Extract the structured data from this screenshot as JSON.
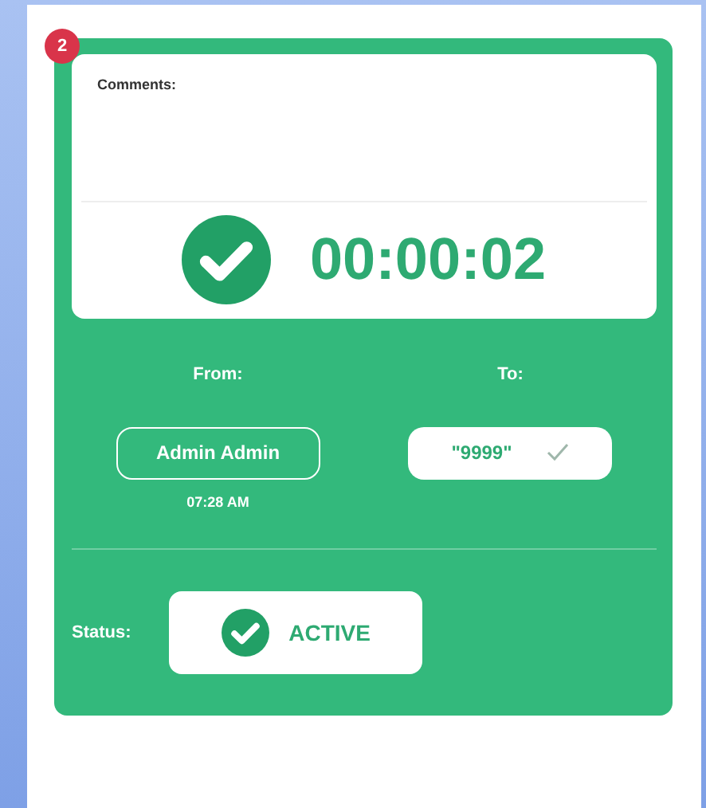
{
  "badge": "2",
  "comments": {
    "label": "Comments:"
  },
  "timer": {
    "done": true,
    "time": "00:00:02"
  },
  "from": {
    "label": "From:",
    "user": "Admin Admin",
    "time": "07:28 AM"
  },
  "to": {
    "label": "To:",
    "value": "\"9999\"",
    "confirmed": true
  },
  "status": {
    "label": "Status:",
    "value": "ACTIVE",
    "active": true
  }
}
